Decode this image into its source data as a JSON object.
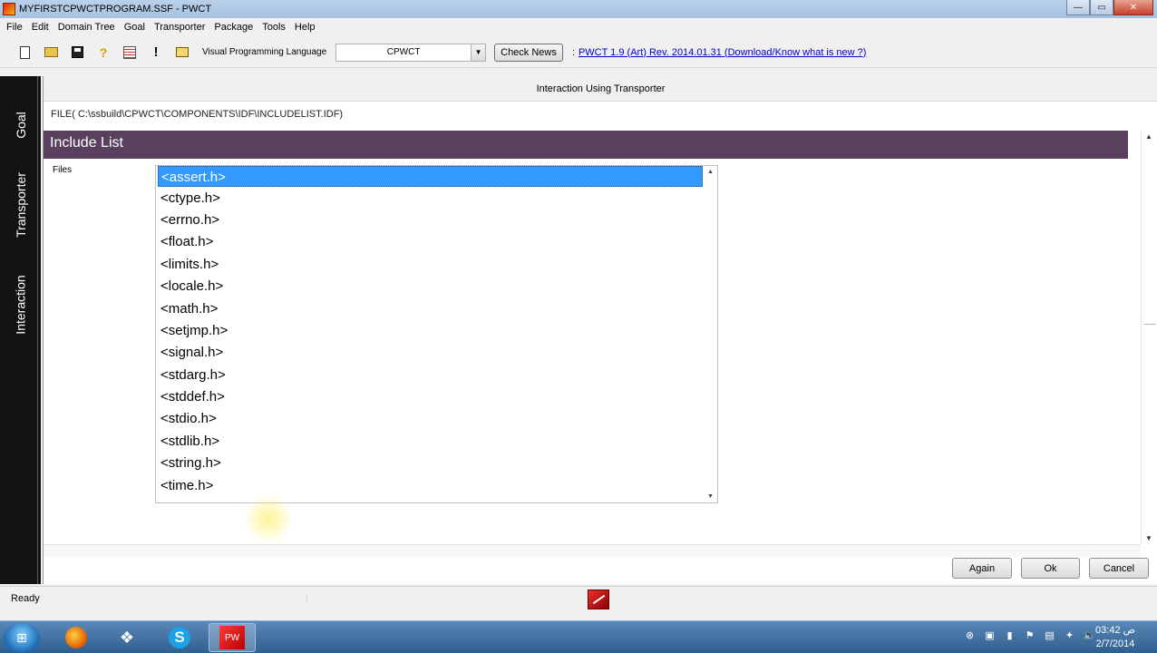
{
  "window": {
    "title": "MYFIRSTCPWCTPROGRAM.SSF - PWCT",
    "controls": {
      "minimize": "—",
      "maximize": "▭",
      "close": "✕"
    }
  },
  "menu": [
    "File",
    "Edit",
    "Domain Tree",
    "Goal",
    "Transporter",
    "Package",
    "Tools",
    "Help"
  ],
  "toolbar": {
    "icons": [
      "new-icon",
      "open-icon",
      "save-icon",
      "help-icon",
      "report-icon",
      "exclamation-icon",
      "folder-icon"
    ],
    "vpl_label": "Visual Programming Language",
    "vpl_value": "CPWCT",
    "check_news_label": "Check News",
    "separator": ":",
    "version_link": "PWCT 1.9 (Art) Rev. 2014.01.31 (Download/Know what is new ?)"
  },
  "left_tabs": [
    "Goal",
    "Transporter",
    "Interaction"
  ],
  "panel": {
    "title": "Interaction Using Transporter",
    "file_path": "FILE( C:\\ssbuild\\CPWCT\\COMPONENTS\\IDF\\INCLUDELIST.IDF)",
    "header": "Include List",
    "files_label": "Files",
    "files": [
      "<assert.h>",
      "<ctype.h>",
      "<errno.h>",
      "<float.h>",
      "<limits.h>",
      "<locale.h>",
      "<math.h>",
      "<setjmp.h>",
      "<signal.h>",
      "<stdarg.h>",
      "<stddef.h>",
      "<stdio.h>",
      "<stdlib.h>",
      "<string.h>",
      "<time.h>"
    ],
    "selected_index": 0,
    "accent_color": "#59405e",
    "selection_color": "#3399ff"
  },
  "buttons": {
    "again": "Again",
    "ok": "Ok",
    "cancel": "Cancel"
  },
  "status": {
    "text": "Ready"
  },
  "taskbar": {
    "clock_time": "03:42 ص",
    "clock_date": "2/7/2014",
    "apps": [
      "start-orb",
      "firefox-icon",
      "network-app-icon",
      "skype-icon",
      "pwct-icon"
    ]
  }
}
